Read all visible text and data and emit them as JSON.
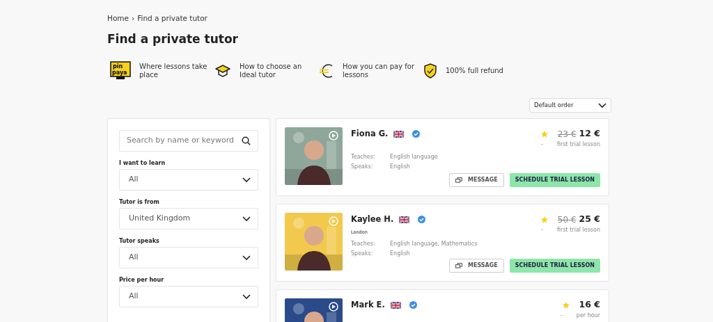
{
  "breadcrumb": [
    {
      "label": "Home"
    },
    {
      "label": "Find a private tutor"
    }
  ],
  "breadcrumb_separator": "›",
  "title": "Find a private tutor",
  "features": [
    {
      "kind": "logo",
      "logo_text": [
        "pin",
        "paya"
      ],
      "label": "Where lessons take place"
    },
    {
      "kind": "cap",
      "label": "How to choose an Ideal tutor"
    },
    {
      "kind": "euro",
      "label": "How you can pay for lessons"
    },
    {
      "kind": "shield",
      "label": "100% full refund"
    }
  ],
  "sort": {
    "value": "Default order"
  },
  "filters": {
    "search": {
      "placeholder": "Search by name or keyword"
    },
    "selects": [
      {
        "label": "I want to learn",
        "value": "All"
      },
      {
        "label": "Tutor is from",
        "value": "United Kingdom"
      },
      {
        "label": "Tutor speaks",
        "value": "All"
      },
      {
        "label": "Price per hour",
        "value": "All"
      }
    ]
  },
  "tutors": [
    {
      "name": "Fiona G.",
      "verified": true,
      "old_price": "23 €",
      "price": "12 €",
      "rating": "-",
      "price_note": "first trial lesson",
      "teaches_label": "Teaches:",
      "teaches": "English language",
      "speaks_label": "Speaks:",
      "speaks": "English",
      "message": "MESSAGE",
      "schedule": "SCHEDULE TRIAL LESSON"
    },
    {
      "name": "Kaylee H.",
      "verified": true,
      "city": "London",
      "old_price": "50 €",
      "price": "25 €",
      "rating": "-",
      "price_note": "first trial lesson",
      "teaches_label": "Teaches:",
      "teaches": "English language, Mathematics",
      "speaks_label": "Speaks:",
      "speaks": "English",
      "message": "MESSAGE",
      "schedule": "SCHEDULE TRIAL LESSON"
    },
    {
      "name": "Mark E.",
      "verified": true,
      "price": "16 €",
      "rating": "-",
      "price_note": "per hour"
    }
  ]
}
